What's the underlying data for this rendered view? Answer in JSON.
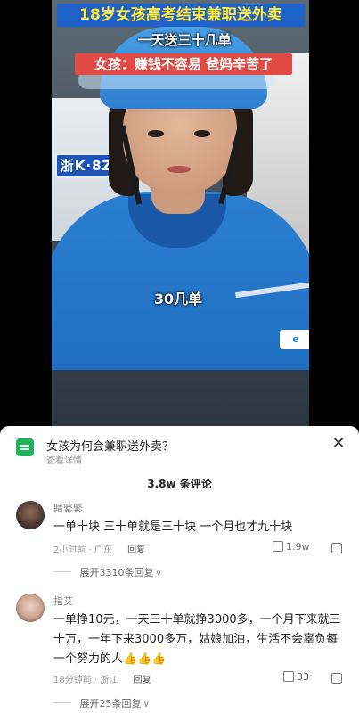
{
  "video": {
    "title_line1": "18岁女孩高考结束兼职送外卖",
    "title_line2": "一天送三十几单",
    "title_line3": "女孩：赚钱不容易 爸妈辛苦了",
    "subtitle": "30几单",
    "plate_text": "浙K·8ZO",
    "colors": {
      "banner_blue": "#1f62c9",
      "banner_yellow": "#ffe93a",
      "banner_red": "#e24b45"
    }
  },
  "sheet": {
    "question": "女孩为何会兼职送外卖？",
    "detail_link": "查看详情",
    "comment_count": "3.8w 条评论"
  },
  "comments": [
    {
      "author": "睛繁繁",
      "text": "一单十块 三十单就是三十块 一个月也才九十块",
      "time": "2小时前 · 广东",
      "reply_label": "回复",
      "likes": "1.9w",
      "expand_label": "展开3310条回复"
    },
    {
      "author": "指艾",
      "text": "一单挣10元，一天三十单就挣3000多，一个月下来就三十万，一年下来3000多万，姑娘加油，生活不会辜负每一个努力的人",
      "emoji": "👍👍👍",
      "time": "18分钟前 · 浙江",
      "reply_label": "回复",
      "likes": "33",
      "expand_label": "展开25条回复"
    }
  ]
}
